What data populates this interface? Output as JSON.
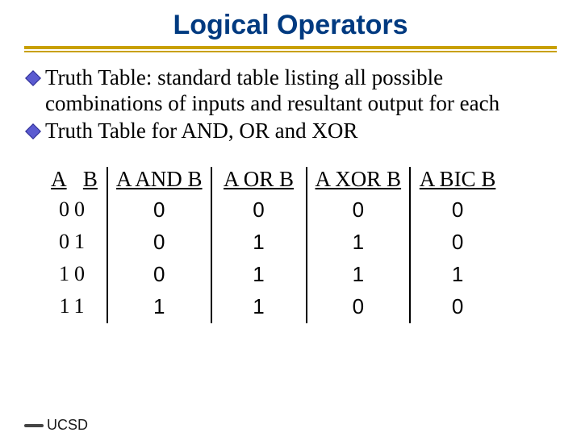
{
  "title": "Logical Operators",
  "bullets": [
    "Truth Table: standard table listing all possible combinations of inputs and resultant output for each",
    "Truth Table for AND, OR and XOR"
  ],
  "table": {
    "col_a": "A",
    "col_b": "B",
    "headers": [
      "A AND B",
      "A OR B",
      "A XOR B",
      "A BIC B"
    ],
    "rows": [
      {
        "A": "0",
        "B": "0",
        "AND": "0",
        "OR": "0",
        "XOR": "0",
        "BIC": "0"
      },
      {
        "A": "0",
        "B": "1",
        "AND": "0",
        "OR": "1",
        "XOR": "1",
        "BIC": "0"
      },
      {
        "A": "1",
        "B": "0",
        "AND": "0",
        "OR": "1",
        "XOR": "1",
        "BIC": "1"
      },
      {
        "A": "1",
        "B": "1",
        "AND": "1",
        "OR": "1",
        "XOR": "0",
        "BIC": "0"
      }
    ]
  },
  "footer": "UCSD"
}
